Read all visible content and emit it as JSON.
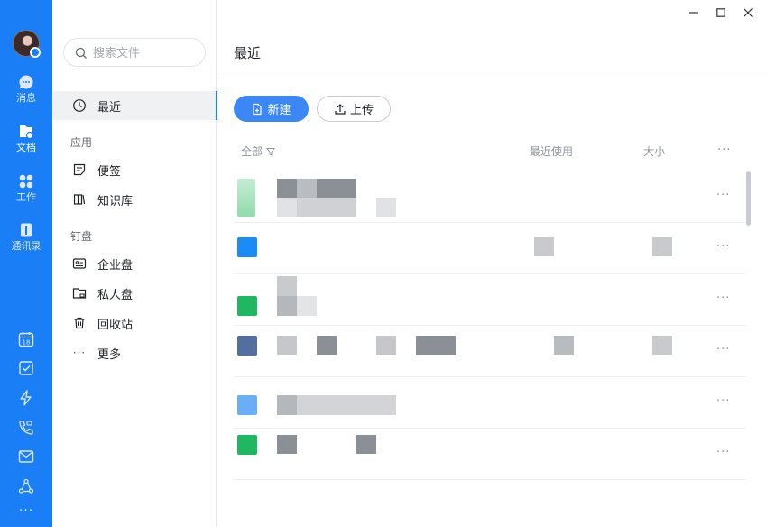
{
  "rail": {
    "items": [
      {
        "label": "消息"
      },
      {
        "label": "文档"
      },
      {
        "label": "工作"
      },
      {
        "label": "通讯录"
      }
    ],
    "calendar_day": "18"
  },
  "side": {
    "search_placeholder": "搜索文件",
    "recent": "最近",
    "section_apps": "应用",
    "notes": "便签",
    "knowledge": "知识库",
    "section_drive": "钉盘",
    "enterprise": "企业盘",
    "personal": "私人盘",
    "trash": "回收站",
    "more": "更多"
  },
  "main": {
    "title": "最近",
    "new_label": "新建",
    "upload_label": "上传",
    "columns": {
      "all": "全部",
      "recent_used": "最近使用",
      "size": "大小"
    },
    "more_glyph": "···"
  },
  "colors": {
    "accent": "#1a7ff7",
    "button": "#3b87f5",
    "file_green": "#1fb760",
    "file_blue": "#1b8cf6",
    "file_navy": "#536fa0",
    "file_lightblue": "#6aaef8"
  }
}
